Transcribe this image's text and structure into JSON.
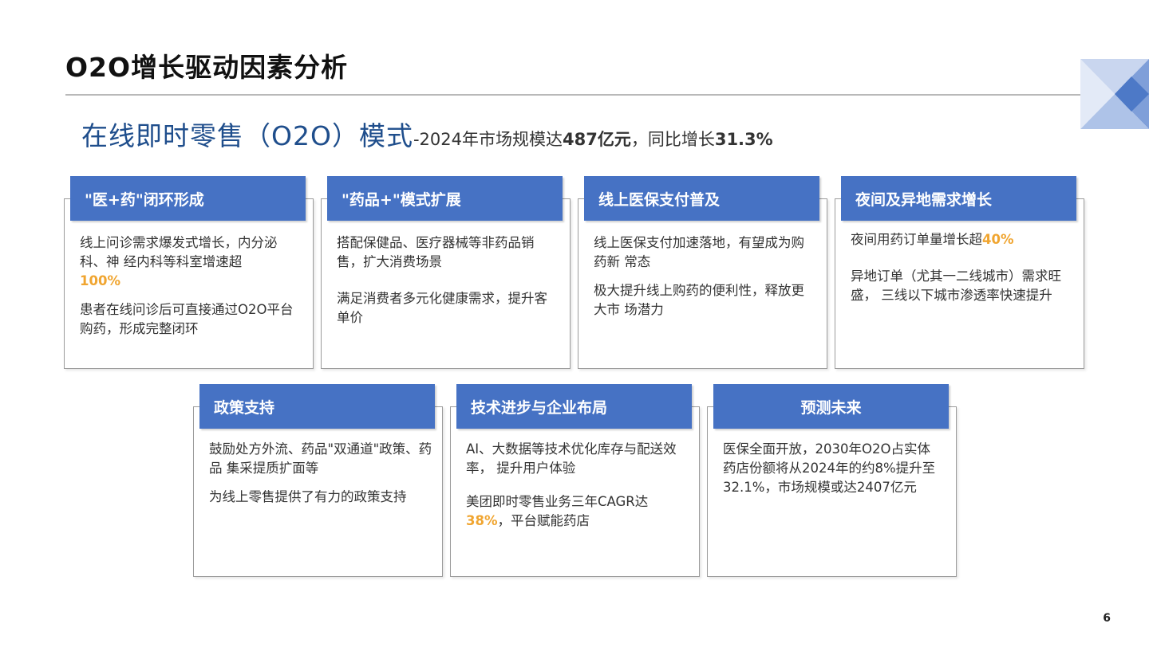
{
  "title": "O2O增长驱动因素分析",
  "subtitle": {
    "main": "在线即时零售（O2O）模式",
    "prefix": "-2024年市场规模达",
    "value1": "487亿元",
    "middle": "，同比增长",
    "value2": "31.3%"
  },
  "colors": {
    "accent_blue": "#4672c4",
    "highlight": "#f0a530",
    "title_blue": "#1f4e8c"
  },
  "cards": [
    {
      "title": "\"医+药\"闭环形成",
      "p1_before": "线上问诊需求爆发式增长，内分泌科、神 经内科等科室增速超",
      "p1_hl": "100%",
      "p2": "患者在线问诊后可直接通过O2O平台购药，形成完整闭环"
    },
    {
      "title": "\"药品+\"模式扩展",
      "p1": "搭配保健品、医疗器械等非药品销售，扩大消费场景",
      "p2": "满足消费者多元化健康需求，提升客单价"
    },
    {
      "title": "线上医保支付普及",
      "p1": "线上医保支付加速落地，有望成为购药新 常态",
      "p2": "极大提升线上购药的便利性，释放更大市 场潜力"
    },
    {
      "title": "夜间及异地需求增长",
      "p1_before": "夜间用药订单量增长超",
      "p1_hl": "40%",
      "p2": "异地订单（尤其一二线城市）需求旺盛，  三线以下城市渗透率快速提升"
    },
    {
      "title": "政策支持",
      "p1": "鼓励处方外流、药品\"双通道\"政策、药品 集采提质扩面等",
      "p2": "为线上零售提供了有力的政策支持"
    },
    {
      "title": "技术进步与企业布局",
      "p1": "AI、大数据等技术优化库存与配送效率，  提升用户体验",
      "p2_before": "美团即时零售业务三年CAGR达",
      "p2_hl": "38%",
      "p2_after": "，平台赋能药店"
    },
    {
      "title": "预测未来",
      "p1": "医保全面开放，2030年O2O占实体药店份额将从2024年的约8%提升至32.1%，市场规模或达2407亿元"
    }
  ],
  "page_number": "6"
}
